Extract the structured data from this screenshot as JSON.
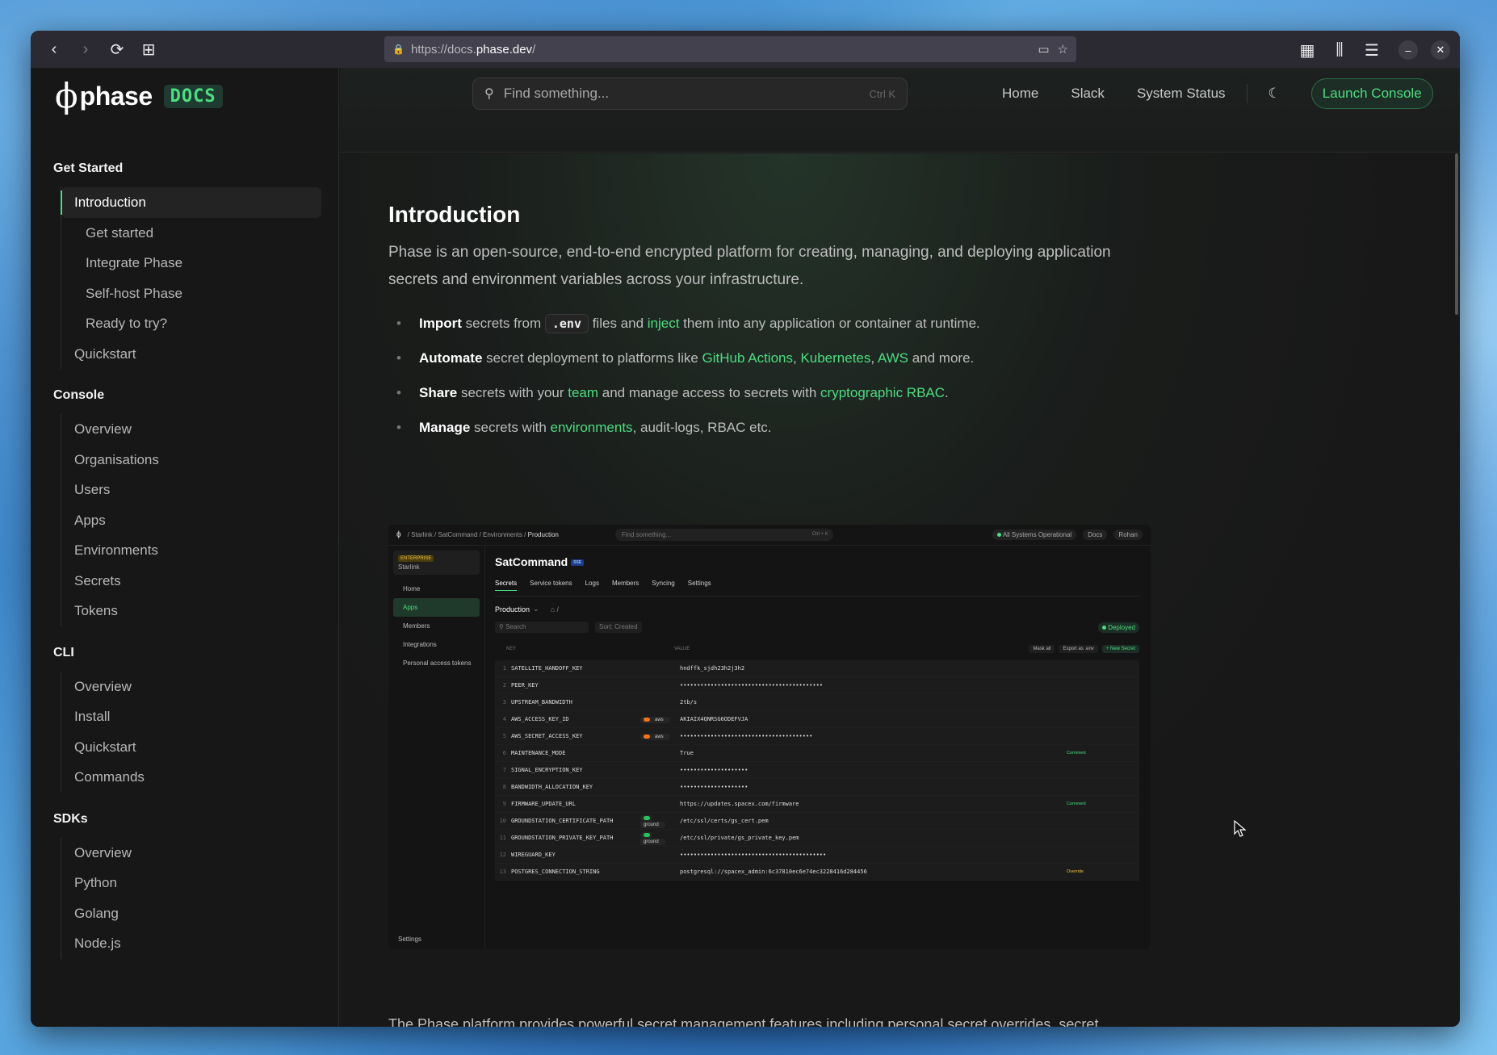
{
  "browser": {
    "url_prefix": "https://docs.",
    "url_host": "phase.dev",
    "url_suffix": "/"
  },
  "logo": {
    "phi": "ϕ",
    "word": "phase",
    "docs": "DOCS"
  },
  "sidebar": {
    "sections": [
      {
        "title": "Get Started",
        "items": [
          {
            "label": "Introduction"
          },
          {
            "label": "Get started"
          },
          {
            "label": "Integrate Phase"
          },
          {
            "label": "Self-host Phase"
          },
          {
            "label": "Ready to try?"
          },
          {
            "label": "Quickstart"
          }
        ]
      },
      {
        "title": "Console",
        "items": [
          {
            "label": "Overview"
          },
          {
            "label": "Organisations"
          },
          {
            "label": "Users"
          },
          {
            "label": "Apps"
          },
          {
            "label": "Environments"
          },
          {
            "label": "Secrets"
          },
          {
            "label": "Tokens"
          }
        ]
      },
      {
        "title": "CLI",
        "items": [
          {
            "label": "Overview"
          },
          {
            "label": "Install"
          },
          {
            "label": "Quickstart"
          },
          {
            "label": "Commands"
          }
        ]
      },
      {
        "title": "SDKs",
        "items": [
          {
            "label": "Overview"
          },
          {
            "label": "Python"
          },
          {
            "label": "Golang"
          },
          {
            "label": "Node.js"
          }
        ]
      }
    ]
  },
  "header": {
    "search_placeholder": "Find something...",
    "search_shortcut": "Ctrl K",
    "links": [
      "Home",
      "Slack",
      "System Status"
    ],
    "cta": "Launch Console"
  },
  "article": {
    "title": "Introduction",
    "lead": "Phase is an open-source, end-to-end encrypted platform for creating, managing, and deploying application secrets and environment variables across your infrastructure.",
    "bullet1": {
      "b": "Import",
      "t1": " secrets from ",
      "code": ".env",
      "t2": " files and ",
      "link": "inject",
      "t3": " them into any application or container at runtime."
    },
    "bullet2": {
      "b": "Automate",
      "t1": " secret deployment to platforms like ",
      "l1": "GitHub Actions",
      "c1": ", ",
      "l2": "Kubernetes",
      "c2": ", ",
      "l3": "AWS",
      "t2": " and more."
    },
    "bullet3": {
      "b": "Share",
      "t1": " secrets with your ",
      "l1": "team",
      "t2": " and manage access to secrets with ",
      "l2": "cryptographic RBAC",
      "t3": "."
    },
    "bullet4": {
      "b": "Manage",
      "t1": " secrets with ",
      "l1": "environments",
      "t2": ", audit-logs, RBAC etc."
    },
    "tail": "The Phase platform provides powerful secret management features including personal secret overrides, secret versioning & roll-back, secret referencing, RBAC, and much more. You can replace .env files with runtime secret inject with a fully-featured"
  },
  "screenshot": {
    "crumbs": [
      "Starlink",
      "SatCommand",
      "Environments",
      "Production"
    ],
    "search": "Find something...",
    "search_kbd": "Ctrl + K",
    "status": "All Systems Operational",
    "docs": "Docs",
    "user": "Rohan",
    "org_badge": "ENTERPRISE",
    "org_name": "Starlink",
    "side_items": [
      "Home",
      "Apps",
      "Members",
      "Integrations",
      "Personal access tokens"
    ],
    "side_settings": "Settings",
    "app_title": "SatCommand",
    "app_tag": "SSE",
    "tabs": [
      "Secrets",
      "Service tokens",
      "Logs",
      "Members",
      "Syncing",
      "Settings"
    ],
    "env": "Production",
    "path": "/",
    "filter_search": "Search",
    "sort": "Sort: Created",
    "deployed": "Deployed",
    "col_key": "KEY",
    "col_value": "VALUE",
    "actions": [
      "Mask all",
      "Export as .env",
      "+ New Secret"
    ],
    "rows": [
      {
        "n": "1",
        "k": "SATELLITE_HANDOFF_KEY",
        "t": "",
        "v": "hndffk_sjdh23h2j3h2",
        "x": ""
      },
      {
        "n": "2",
        "k": "PEER_KEY",
        "t": "",
        "v": "••••••••••••••••••••••••••••••••••••••••••",
        "x": ""
      },
      {
        "n": "3",
        "k": "UPSTREAM_BANDWIDTH",
        "t": "",
        "v": "2tb/s",
        "x": ""
      },
      {
        "n": "4",
        "k": "AWS_ACCESS_KEY_ID",
        "t": "aws",
        "v": "AKIAIX4QNRSG6ODEFVJA",
        "x": ""
      },
      {
        "n": "5",
        "k": "AWS_SECRET_ACCESS_KEY",
        "t": "aws",
        "v": "•••••••••••••••••••••••••••••••••••••••",
        "x": ""
      },
      {
        "n": "6",
        "k": "MAINTENANCE_MODE",
        "t": "",
        "v": "True",
        "x": "Comment"
      },
      {
        "n": "7",
        "k": "SIGNAL_ENCRYPTION_KEY",
        "t": "",
        "v": "••••••••••••••••••••",
        "x": ""
      },
      {
        "n": "8",
        "k": "BANDWIDTH_ALLOCATION_KEY",
        "t": "",
        "v": "••••••••••••••••••••",
        "x": ""
      },
      {
        "n": "9",
        "k": "FIRMWARE_UPDATE_URL",
        "t": "",
        "v": "https://updates.spacex.com/firmware",
        "x": "Comment"
      },
      {
        "n": "10",
        "k": "GROUNDSTATION_CERTIFICATE_PATH",
        "t": "ground",
        "v": "/etc/ssl/certs/gs_cert.pem",
        "x": ""
      },
      {
        "n": "11",
        "k": "GROUNDSTATION_PRIVATE_KEY_PATH",
        "t": "ground",
        "v": "/etc/ssl/private/gs_private_key.pem",
        "x": ""
      },
      {
        "n": "12",
        "k": "WIREGUARD_KEY",
        "t": "",
        "v": "•••••••••••••••••••••••••••••••••••••••••••",
        "x": ""
      },
      {
        "n": "13",
        "k": "POSTGRES_CONNECTION_STRING",
        "t": "",
        "v": "postgresql://spacex_admin:6c37810ec6e74ec3228416d284456",
        "x": "Override"
      }
    ]
  }
}
